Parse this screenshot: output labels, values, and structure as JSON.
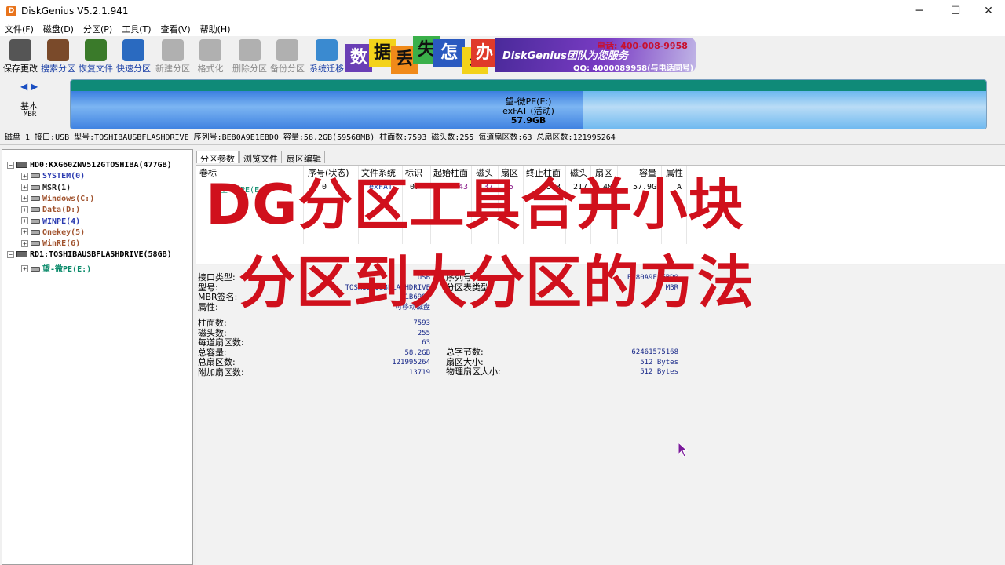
{
  "window": {
    "title": "DiskGenius V5.2.1.941",
    "minimize": "─",
    "maximize": "☐",
    "close": "✕"
  },
  "menu": [
    "文件(F)",
    "磁盘(D)",
    "分区(P)",
    "工具(T)",
    "查看(V)",
    "帮助(H)"
  ],
  "toolbar": [
    {
      "label": "保存更改",
      "state": "normal",
      "color": "#555555"
    },
    {
      "label": "搜索分区",
      "state": "active",
      "color": "#7a4a2a"
    },
    {
      "label": "恢复文件",
      "state": "active",
      "color": "#3a7a2a"
    },
    {
      "label": "快速分区",
      "state": "active",
      "color": "#2a6ac0"
    },
    {
      "label": "新建分区",
      "state": "disabled",
      "color": "#b0b0b0"
    },
    {
      "label": "格式化",
      "state": "disabled",
      "color": "#b0b0b0"
    },
    {
      "label": "删除分区",
      "state": "disabled",
      "color": "#b0b0b0"
    },
    {
      "label": "备份分区",
      "state": "disabled",
      "color": "#b0b0b0"
    },
    {
      "label": "系统迁移",
      "state": "active",
      "color": "#3a8ad0"
    }
  ],
  "banner": {
    "chars": [
      "数",
      "据",
      "丢",
      "失",
      "怎",
      "么",
      "办"
    ],
    "slogan": "DiskGenius团队为您服务",
    "phone": "电话: 400-008-9958",
    "qq": "QQ: 4000089958(与电话同号)"
  },
  "diskmap": {
    "nav": "◀ ▶",
    "type": "基本",
    "style": "MBR",
    "partition_name": "望-微PE(E:)",
    "partition_fs": "exFAT (活动)",
    "partition_size": "57.9GB",
    "used_fraction": 0.56
  },
  "infobar": "磁盘 1 接口:USB  型号:TOSHIBAUSBFLASHDRIVE  序列号:BE80A9E1EBD0  容量:58.2GB(59568MB)  柱面数:7593  磁头数:255  每道扇区数:63  总扇区数:121995264",
  "tree": [
    {
      "label": "HD0:KXG60ZNV512GTOSHIBA(477GB)",
      "level": 0,
      "type": "disk",
      "color": "#000000"
    },
    {
      "label": "SYSTEM(0)",
      "level": 1,
      "type": "part",
      "color": "#2a3ab0"
    },
    {
      "label": "MSR(1)",
      "level": 1,
      "type": "part",
      "color": "#222222"
    },
    {
      "label": "Windows(C:)",
      "level": 1,
      "type": "part",
      "color": "#a0522d"
    },
    {
      "label": "Data(D:)",
      "level": 1,
      "type": "part",
      "color": "#a0522d"
    },
    {
      "label": "WINPE(4)",
      "level": 1,
      "type": "part",
      "color": "#2a3ab0"
    },
    {
      "label": "Onekey(5)",
      "level": 1,
      "type": "part",
      "color": "#a0522d"
    },
    {
      "label": "WinRE(6)",
      "level": 1,
      "type": "part",
      "color": "#a0522d"
    },
    {
      "label": "RD1:TOSHIBAUSBFLASHDRIVE(58GB)",
      "level": 0,
      "type": "disk",
      "color": "#000000"
    },
    {
      "label": "望-微PE(E:)",
      "level": 1,
      "type": "part",
      "color": "#0a8a6a"
    }
  ],
  "tabs": [
    "分区参数",
    "浏览文件",
    "扇区编辑"
  ],
  "table": {
    "headers": [
      "卷标",
      "序号(状态)",
      "文件系统",
      "标识",
      "起始柱面",
      "磁头",
      "扇区",
      "终止柱面",
      "磁头",
      "扇区",
      "容量",
      "属性"
    ],
    "row": [
      "望-微PE(E:)",
      "0",
      "exFAT",
      "07",
      "43",
      "37",
      "5",
      "7593",
      "217",
      "48",
      "57.9GB",
      "A"
    ]
  },
  "details": {
    "left": [
      {
        "label": "接口类型:",
        "value": "USB"
      },
      {
        "label": "型号:",
        "value": "TOSHIBAUSBFLASHDRIVE"
      },
      {
        "label": "MBR签名:",
        "value": "1B6993"
      },
      {
        "label": "属性:",
        "value": "可移动磁盘"
      }
    ],
    "right": [
      {
        "label": "序列号:",
        "value": "BE80A9E1EBD0"
      },
      {
        "label": "分区表类型:",
        "value": "MBR"
      }
    ],
    "geo": [
      {
        "label": "柱面数:",
        "value": "7593"
      },
      {
        "label": "磁头数:",
        "value": "255"
      },
      {
        "label": "每道扇区数:",
        "value": "63"
      },
      {
        "label": "总容量:",
        "value": "58.2GB"
      },
      {
        "label": "总扇区数:",
        "value": "121995264"
      },
      {
        "label": "附加扇区数:",
        "value": "13719"
      }
    ],
    "geo_right": [
      {
        "label": "总字节数:",
        "value": "62461575168"
      },
      {
        "label": "扇区大小:",
        "value": "512 Bytes"
      },
      {
        "label": "物理扇区大小:",
        "value": "512 Bytes"
      }
    ]
  },
  "overlay": {
    "line1": "DG分区工具合并小块",
    "line2": "分区到大分区的方法"
  }
}
